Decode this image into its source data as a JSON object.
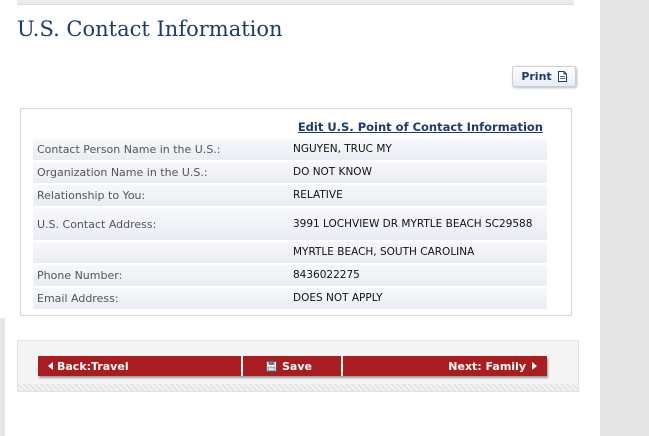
{
  "page": {
    "title": "U.S. Contact Information"
  },
  "toolbar": {
    "print_label": "Print",
    "print_icon": "document-icon"
  },
  "contact": {
    "edit_link": "Edit U.S. Point of Contact Information",
    "rows": [
      {
        "label": "Contact Person Name in the U.S.:",
        "value": "NGUYEN, TRUC MY"
      },
      {
        "label": "Organization Name in the U.S.:",
        "value": "DO NOT KNOW"
      },
      {
        "label": "Relationship to You:",
        "value": "RELATIVE"
      },
      {
        "label": "U.S. Contact Address:",
        "value": "3991 LOCHVIEW DR MYRTLE BEACH SC29588"
      },
      {
        "label": "",
        "value": "MYRTLE BEACH, SOUTH CAROLINA"
      },
      {
        "label": "Phone Number:",
        "value": "8436022275"
      },
      {
        "label": "Email Address:",
        "value": "DOES NOT APPLY"
      }
    ]
  },
  "navigation": {
    "back_label": "Back:Travel",
    "save_label": "Save",
    "next_label": "Next: Family"
  },
  "colors": {
    "title": "#1f3a6b",
    "nav_red": "#a91d21",
    "row_band": "#e9ecf3"
  }
}
